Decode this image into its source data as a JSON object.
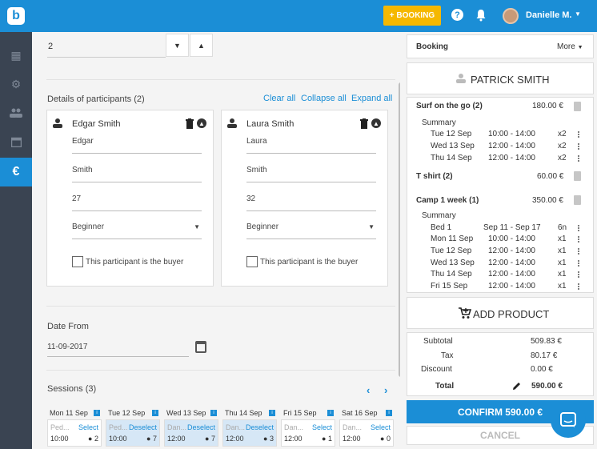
{
  "topbar": {
    "logo": "b",
    "booking_button": "+ BOOKING",
    "help_icon": "help-icon",
    "bell_icon": "bell-icon",
    "user_name": "Danielle M."
  },
  "sidebar": {
    "items": [
      {
        "name": "dashboard-icon",
        "glyph": "▦"
      },
      {
        "name": "settings-icon",
        "glyph": "⚙"
      },
      {
        "name": "people-icon",
        "glyph": "👥"
      },
      {
        "name": "calendar-icon",
        "glyph": "▤"
      },
      {
        "name": "euro-icon",
        "glyph": "€"
      }
    ]
  },
  "main": {
    "quantity_value": "2",
    "participants_title": "Details of participants (2)",
    "clear_all": "Clear all",
    "collapse_all": "Collapse all",
    "expand_all": "Expand all",
    "participants": [
      {
        "name": "Edgar Smith",
        "first": "Edgar",
        "last": "Smith",
        "age": "27",
        "level": "Beginner",
        "buyer_label": "This participant is the buyer"
      },
      {
        "name": "Laura Smith",
        "first": "Laura",
        "last": "Smith",
        "age": "32",
        "level": "Beginner",
        "buyer_label": "This participant is the buyer"
      }
    ],
    "date_from_label": "Date From",
    "date_from_value": "11-09-2017",
    "sessions_title": "Sessions (3)",
    "days": [
      {
        "head": "Mon 11 Sep",
        "label": "Ped...",
        "action": "Select",
        "time": "10:00",
        "count": "2",
        "selected": false
      },
      {
        "head": "Tue 12 Sep",
        "label": "Ped...",
        "action": "Deselect",
        "time": "10:00",
        "count": "7",
        "selected": true
      },
      {
        "head": "Wed 13 Sep",
        "label": "Dan...",
        "action": "Deselect",
        "time": "12:00",
        "count": "7",
        "selected": true
      },
      {
        "head": "Thu 14 Sep",
        "label": "Dan...",
        "action": "Deselect",
        "time": "12:00",
        "count": "3",
        "selected": true
      },
      {
        "head": "Fri 15 Sep",
        "label": "Dan...",
        "action": "Select",
        "time": "12:00",
        "count": "1",
        "selected": false
      },
      {
        "head": "Sat 16 Sep",
        "label": "Dan...",
        "action": "Select",
        "time": "12:00",
        "count": "0",
        "selected": false
      }
    ]
  },
  "panel": {
    "booking_label": "Booking",
    "more_label": "More",
    "customer_name": "PATRICK SMITH",
    "items": [
      {
        "title": "Surf on the go (2)",
        "price": "180.00 €"
      },
      {
        "title": "T shirt (2)",
        "price": "60.00 €"
      },
      {
        "title": "Camp 1 week (1)",
        "price": "350.00 €"
      }
    ],
    "summary_label": "Summary",
    "surf_rows": [
      {
        "date": "Tue 12 Sep",
        "time": "10:00 - 14:00",
        "qty": "x2"
      },
      {
        "date": "Wed 13 Sep",
        "time": "12:00 - 14:00",
        "qty": "x2"
      },
      {
        "date": "Thu 14 Sep",
        "time": "12:00 - 14:00",
        "qty": "x2"
      }
    ],
    "camp_rows": [
      {
        "date": "Bed 1",
        "time": "Sep 11 - Sep 17",
        "qty": "6n"
      },
      {
        "date": "Mon 11 Sep",
        "time": "10:00 - 14:00",
        "qty": "x1"
      },
      {
        "date": "Tue 12 Sep",
        "time": "12:00 - 14:00",
        "qty": "x1"
      },
      {
        "date": "Wed 13 Sep",
        "time": "12:00 - 14:00",
        "qty": "x1"
      },
      {
        "date": "Thu 14 Sep",
        "time": "12:00 - 14:00",
        "qty": "x1"
      },
      {
        "date": "Fri 15 Sep",
        "time": "12:00 - 14:00",
        "qty": "x1"
      }
    ],
    "add_product": "ADD PRODUCT",
    "totals": {
      "subtotal_label": "Subtotal",
      "subtotal": "509.83 €",
      "tax_label": "Tax",
      "tax": "80.17 €",
      "discount_label": "Discount",
      "discount": "0.00 €",
      "total_label": "Total",
      "total": "590.00 €"
    },
    "confirm": "CONFIRM 590.00 €",
    "cancel": "CANCEL"
  },
  "colors": {
    "accent": "#1b8ed6",
    "booking": "#f5b800",
    "sidebar": "#3a4452"
  }
}
